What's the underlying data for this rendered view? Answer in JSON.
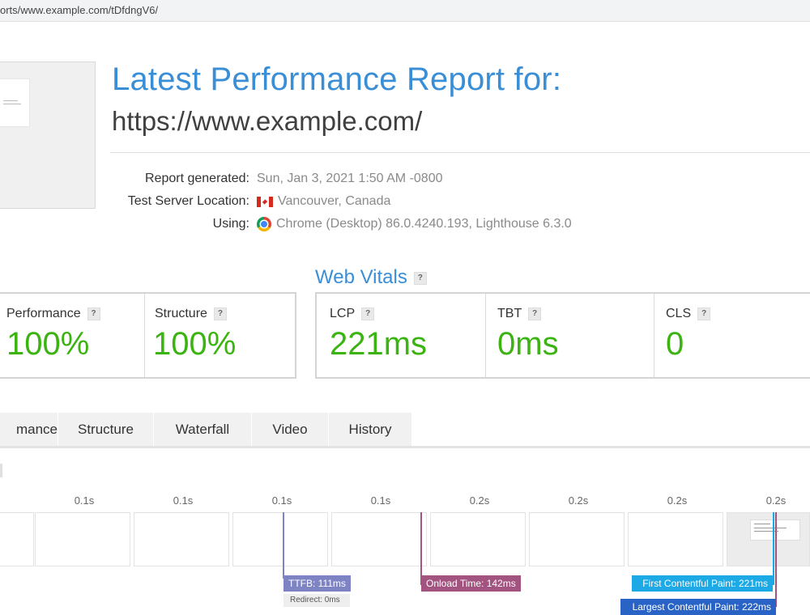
{
  "browser": {
    "url": "orts/www.example.com/tDfdngV6/"
  },
  "header": {
    "title": "Latest Performance Report for:",
    "url": "https://www.example.com/"
  },
  "meta": {
    "report_generated_label": "Report generated:",
    "report_generated_value": "Sun, Jan 3, 2021 1:50 AM -0800",
    "server_location_label": "Test Server Location:",
    "server_location_value": "Vancouver, Canada",
    "using_label": "Using:",
    "using_value": "Chrome (Desktop) 86.0.4240.193, Lighthouse 6.3.0"
  },
  "grades": {
    "performance_label": "Performance",
    "performance_value": "100%",
    "structure_label": "Structure",
    "structure_value": "100%"
  },
  "web_vitals": {
    "title": "Web Vitals",
    "lcp_label": "LCP",
    "lcp_value": "221ms",
    "tbt_label": "TBT",
    "tbt_value": "0ms",
    "cls_label": "CLS",
    "cls_value": "0"
  },
  "help_icon_text": "?",
  "tabs": [
    "mance",
    "Structure",
    "Waterfall",
    "Video",
    "History"
  ],
  "timeline": {
    "ticks": [
      "0.1s",
      "0.1s",
      "0.1s",
      "0.1s",
      "0.2s",
      "0.2s",
      "0.2s",
      "0.2s"
    ],
    "markers": {
      "ttfb": "TTFB: 111ms",
      "redirect": "Redirect: 0ms",
      "onload": "Onload Time: 142ms",
      "fcp": "First Contentful Paint: 221ms",
      "lcp": "Largest Contentful Paint: 222ms"
    }
  },
  "colors": {
    "accent": "#3a8ed6",
    "score_green": "#3bb311",
    "ttfb": "#7e83c4",
    "onload": "#a3537f",
    "fcp": "#1ca9e6",
    "lcp": "#2a63c6"
  }
}
